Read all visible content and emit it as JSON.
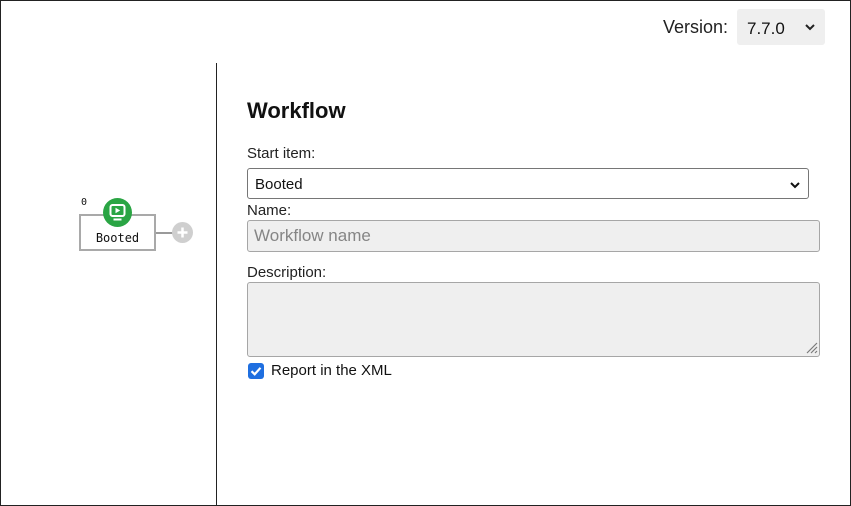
{
  "header": {
    "version_label": "Version:",
    "version_value": "7.7.0",
    "version_chevron_icon": "chevron-down-icon"
  },
  "canvas": {
    "node": {
      "count": "0",
      "label": "Booted",
      "icon": "monitor-play-icon",
      "icon_color": "#2aa544",
      "add_icon": "plus-circle-icon"
    }
  },
  "form": {
    "title": "Workflow",
    "start_item_label": "Start item:",
    "start_item_value": "Booted",
    "name_label": "Name:",
    "name_value": "",
    "name_placeholder": "Workflow name",
    "description_label": "Description:",
    "description_value": "",
    "report_label": "Report in the XML",
    "report_checked": true,
    "accent_color": "#1f6fe0"
  }
}
